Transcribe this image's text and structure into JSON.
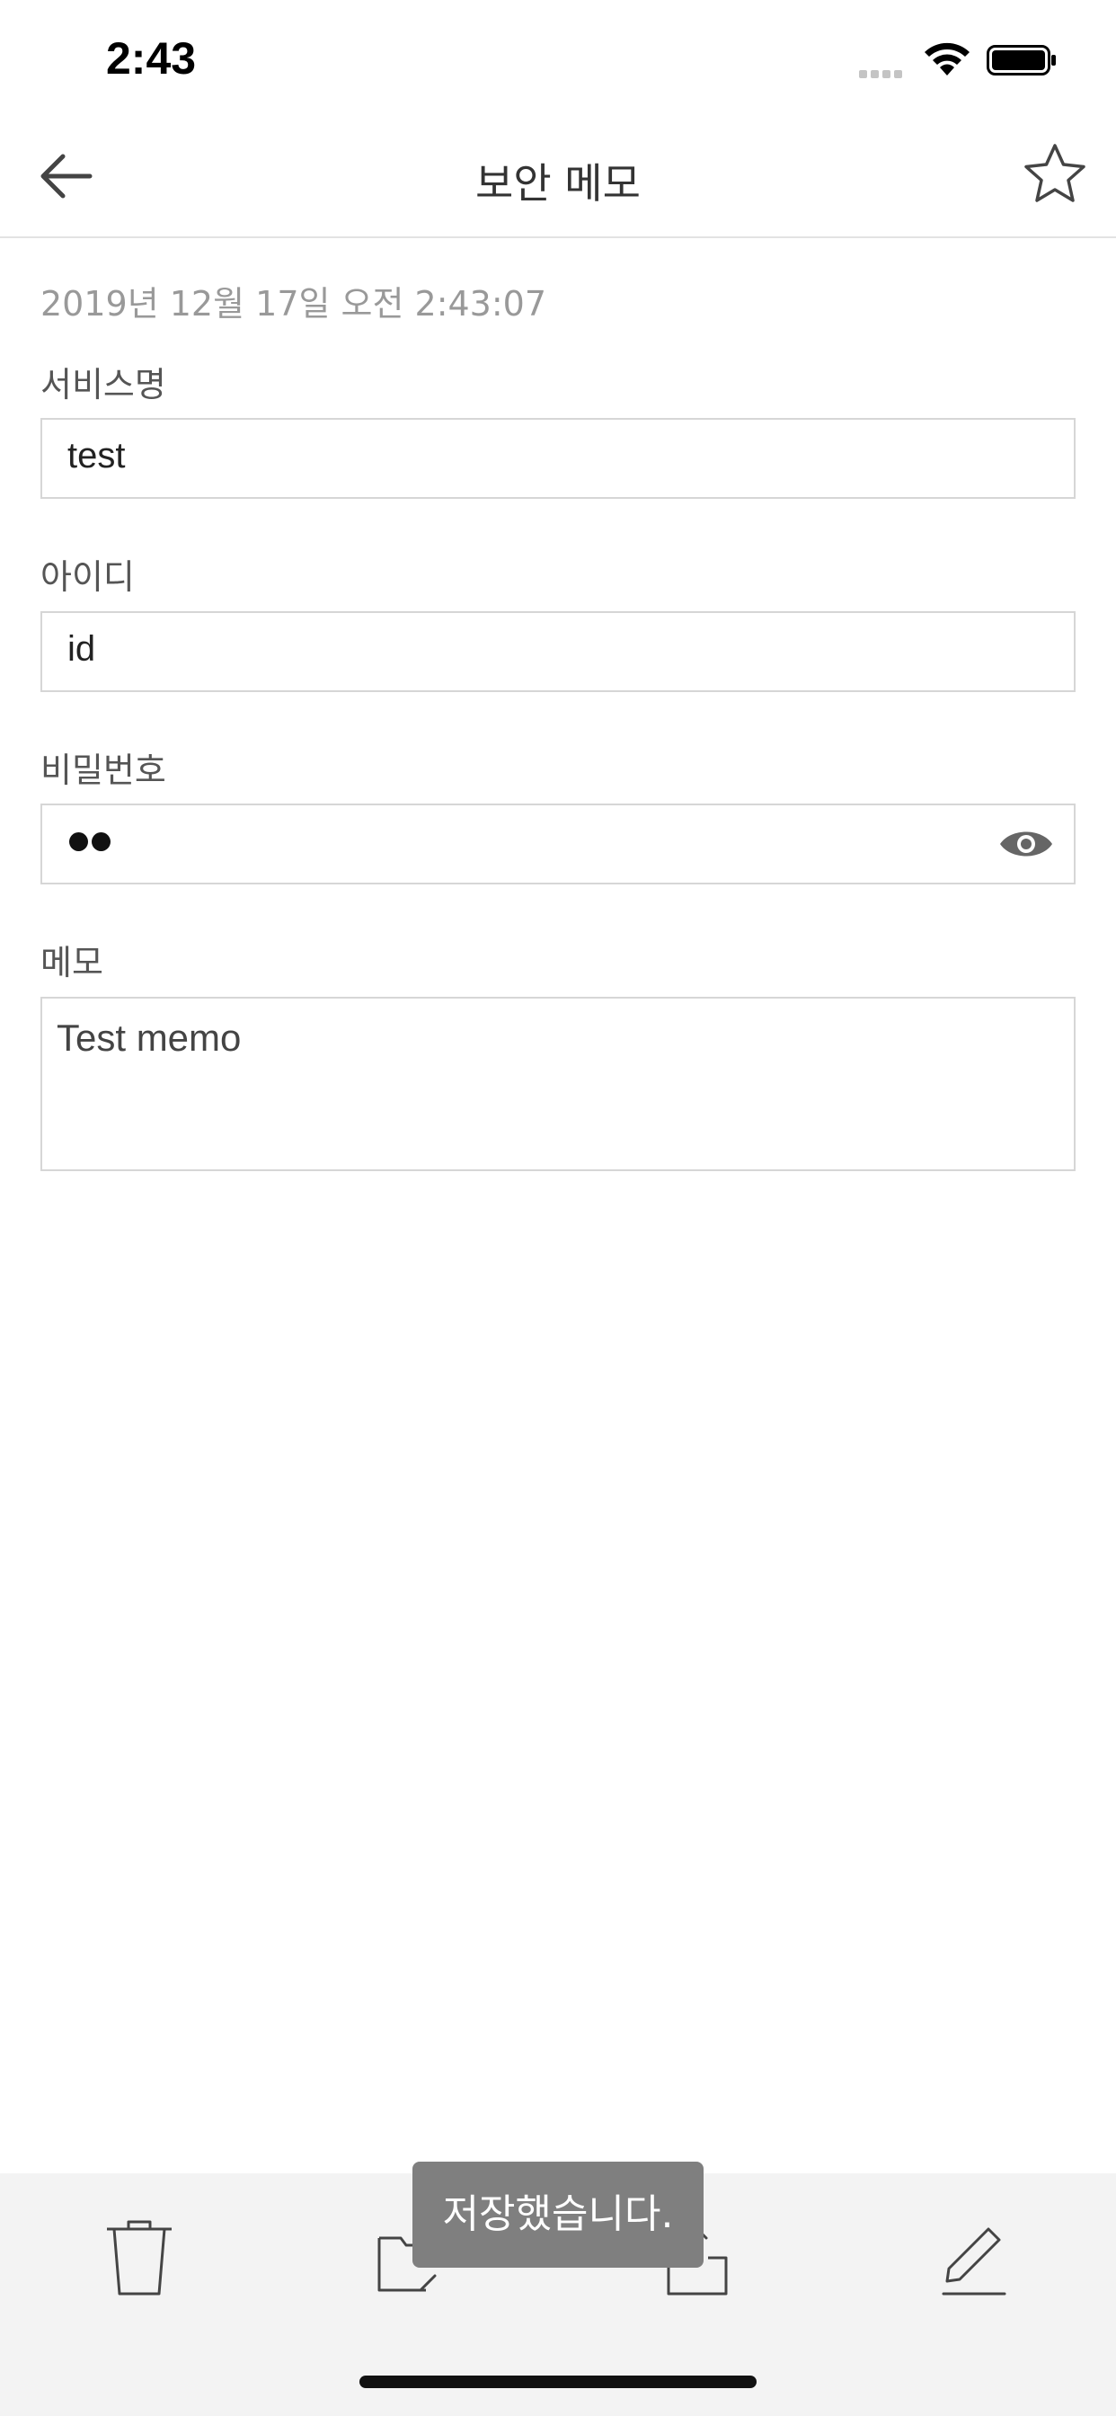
{
  "status_bar": {
    "time": "2:43",
    "signal_icon": "signal-dots-icon",
    "wifi_icon": "wifi-icon",
    "battery_icon": "battery-icon"
  },
  "nav": {
    "title": "보안 메모",
    "back_icon": "arrow-left-icon",
    "favorite_icon": "star-outline-icon"
  },
  "memo": {
    "date": "2019년 12월 17일 오전 2:43:07",
    "service_label": "서비스명",
    "service_value": "test",
    "id_label": "아이디",
    "id_value": "id",
    "password_label": "비밀번호",
    "password_dot_count": 2,
    "memo_label": "메모",
    "memo_value": "Test memo"
  },
  "toolbar": {
    "items": [
      "trash-icon",
      "move-folder-icon",
      "share-icon",
      "edit-pencil-icon"
    ]
  },
  "toast": {
    "message": "저장했습니다."
  },
  "colors": {
    "text_primary": "#333333",
    "text_secondary": "#999999",
    "border": "#d6d6d6",
    "toolbar_bg": "#f3f3f3",
    "toast_bg": "#7f7f7f"
  }
}
